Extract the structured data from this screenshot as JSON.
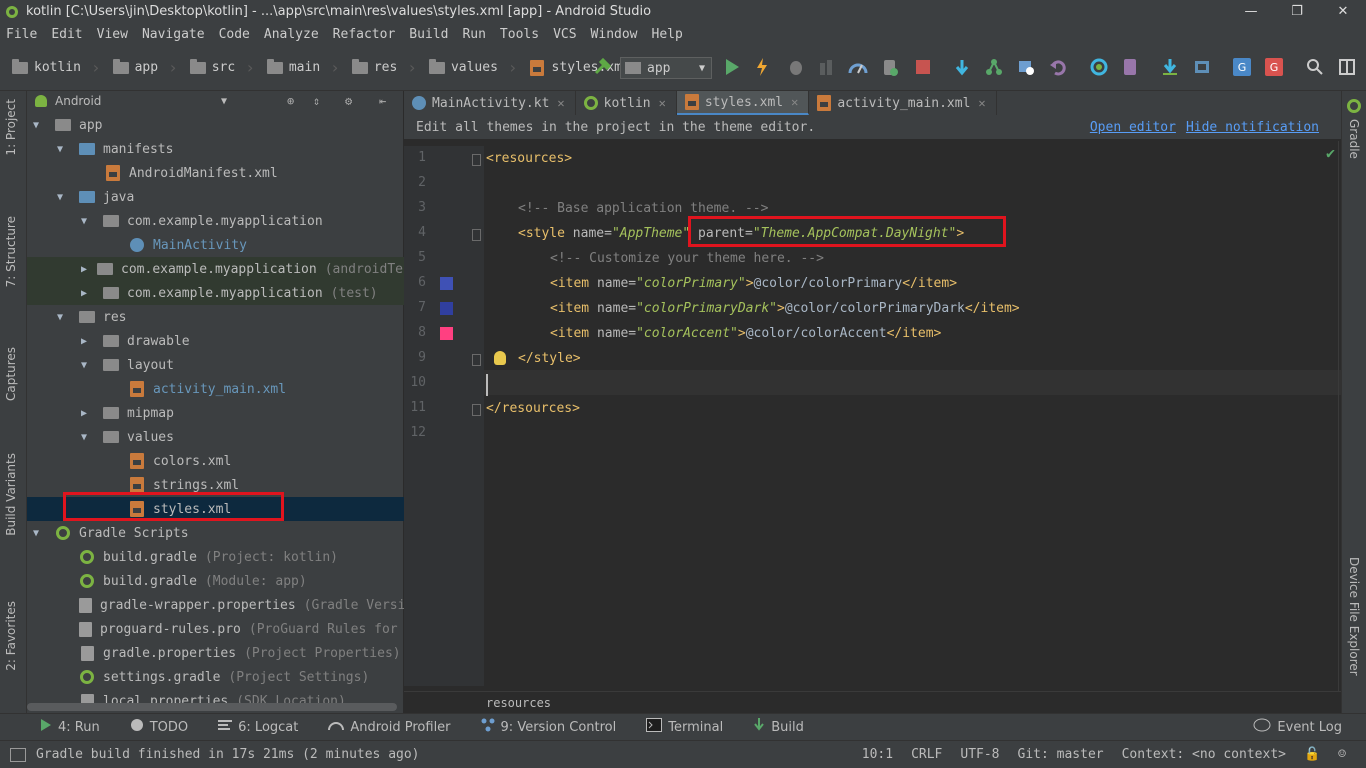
{
  "window": {
    "title": "kotlin [C:\\Users\\jin\\Desktop\\kotlin] - ...\\app\\src\\main\\res\\values\\styles.xml [app] - Android Studio",
    "minimize": "—",
    "maximize": "❐",
    "close": "✕"
  },
  "menu": [
    "File",
    "Edit",
    "View",
    "Navigate",
    "Code",
    "Analyze",
    "Refactor",
    "Build",
    "Run",
    "Tools",
    "VCS",
    "Window",
    "Help"
  ],
  "breadcrumbs": [
    "kotlin",
    "app",
    "src",
    "main",
    "res",
    "values",
    "styles.xml"
  ],
  "run_config": "app",
  "project_panel": {
    "view_mode": "Android",
    "tree": [
      {
        "label": "app",
        "hint": ""
      },
      {
        "label": "manifests",
        "hint": ""
      },
      {
        "label": "AndroidManifest.xml",
        "hint": ""
      },
      {
        "label": "java",
        "hint": ""
      },
      {
        "label": "com.example.myapplication",
        "hint": ""
      },
      {
        "label": "MainActivity",
        "hint": ""
      },
      {
        "label": "com.example.myapplication",
        "hint": "(androidTest)"
      },
      {
        "label": "com.example.myapplication",
        "hint": "(test)"
      },
      {
        "label": "res",
        "hint": ""
      },
      {
        "label": "drawable",
        "hint": ""
      },
      {
        "label": "layout",
        "hint": ""
      },
      {
        "label": "activity_main.xml",
        "hint": ""
      },
      {
        "label": "mipmap",
        "hint": ""
      },
      {
        "label": "values",
        "hint": ""
      },
      {
        "label": "colors.xml",
        "hint": ""
      },
      {
        "label": "strings.xml",
        "hint": ""
      },
      {
        "label": "styles.xml",
        "hint": ""
      },
      {
        "label": "Gradle Scripts",
        "hint": ""
      },
      {
        "label": "build.gradle",
        "hint": "(Project: kotlin)"
      },
      {
        "label": "build.gradle",
        "hint": "(Module: app)"
      },
      {
        "label": "gradle-wrapper.properties",
        "hint": "(Gradle Version)"
      },
      {
        "label": "proguard-rules.pro",
        "hint": "(ProGuard Rules for app)"
      },
      {
        "label": "gradle.properties",
        "hint": "(Project Properties)"
      },
      {
        "label": "settings.gradle",
        "hint": "(Project Settings)"
      },
      {
        "label": "local.properties",
        "hint": "(SDK Location)"
      }
    ]
  },
  "left_tabs": [
    "1: Project",
    "7: Structure",
    "Captures",
    "Build Variants",
    "2: Favorites"
  ],
  "right_tabs": [
    "Gradle",
    "Device File Explorer"
  ],
  "editor_tabs": [
    {
      "label": "MainActivity.kt"
    },
    {
      "label": "kotlin"
    },
    {
      "label": "styles.xml"
    },
    {
      "label": "activity_main.xml"
    }
  ],
  "notification": {
    "text": "Edit all themes in the project in the theme editor.",
    "open_editor": "Open editor",
    "hide": "Hide notification"
  },
  "line_numbers": [
    "1",
    "2",
    "3",
    "4",
    "5",
    "6",
    "7",
    "8",
    "9",
    "10",
    "11",
    "12"
  ],
  "code": {
    "l1_open": "<resources>",
    "l3_comment": "<!-- Base application theme. -->",
    "l4_style_open": "<style",
    "l4_name_attr": " name=",
    "l4_name_val": "\"AppTheme\"",
    "l4_parent_attr": " parent=",
    "l4_parent_val": "\"Theme.AppCompat.DayNight\"",
    "l4_close": ">",
    "l5_comment": "<!-- Customize your theme here. -->",
    "item_open": "<item",
    "item_name_attr": " name=",
    "l6_name": "\"colorPrimary\"",
    "l6_value": "@color/colorPrimary",
    "l7_name": "\"colorPrimaryDark\"",
    "l7_value": "@color/colorPrimaryDark",
    "l8_name": "\"colorAccent\"",
    "l8_value": "@color/colorAccent",
    "item_close_bracket": ">",
    "item_end": "</item>",
    "l9_style_end": "</style>",
    "l11_end": "</resources>"
  },
  "swatch_colors": {
    "colorPrimary": "#3f51b5",
    "colorPrimaryDark": "#303f9f",
    "colorAccent": "#ff4081"
  },
  "editor_breadcrumb": "resources",
  "bottom_tools": [
    {
      "label": "4: Run"
    },
    {
      "label": "TODO"
    },
    {
      "label": "6: Logcat"
    },
    {
      "label": "Android Profiler"
    },
    {
      "label": "9: Version Control"
    },
    {
      "label": "Terminal"
    },
    {
      "label": "Build"
    },
    {
      "label": "Event Log"
    }
  ],
  "status": {
    "message": "Gradle build finished in 17s 21ms (2 minutes ago)",
    "position": "10:1",
    "line_sep": "CRLF",
    "encoding": "UTF-8",
    "git": "Git: master",
    "context": "Context: <no context>"
  },
  "colors": {
    "highlight": "#e0141e",
    "accent": "#4a88c7",
    "selection": "#0d293e"
  }
}
